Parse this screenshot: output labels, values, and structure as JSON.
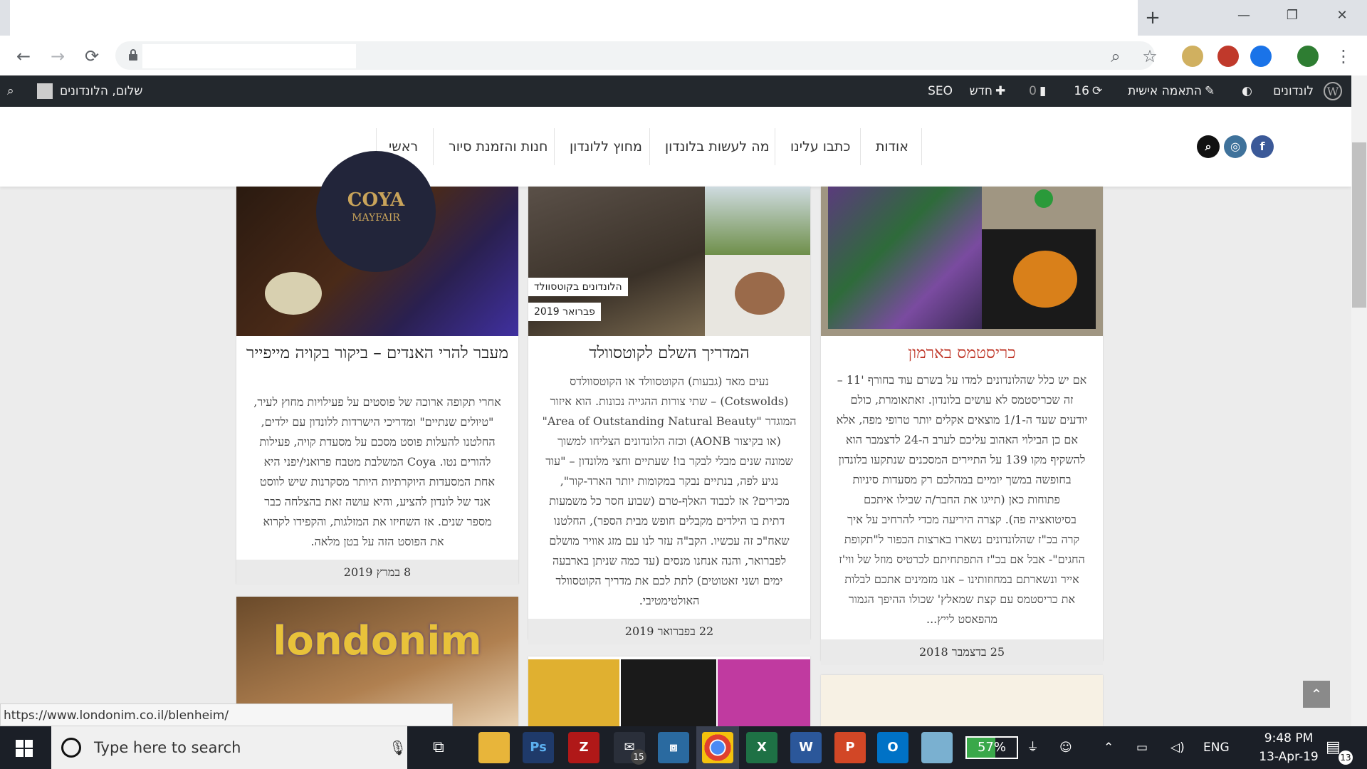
{
  "browser": {
    "new_tab": "+",
    "window_buttons": [
      "—",
      "❐",
      "✕"
    ],
    "back": "←",
    "forward": "→",
    "reload": "⟳",
    "zoom_icon": "⌕",
    "star_icon": "☆",
    "menu_icon": "⋮",
    "extensions": [
      "shield-extension-icon",
      "adblock-extension-icon",
      "a-extension-icon",
      "profile-avatar"
    ],
    "status_url": "https://www.londonim.co.il/blenheim/"
  },
  "admin_bar": {
    "site_name": "לונדונים",
    "customize": "התאמה אישית",
    "updates_count": "16",
    "comments_count": "0",
    "new_label": "חדש",
    "seo_label": "SEO",
    "greeting": "שלום, הלונדונים"
  },
  "nav": {
    "items": [
      "אודות",
      "כתבו עלינו",
      "מה לעשות בלונדון",
      "מחוץ ללונדון",
      "חנות והזמנת סיור",
      "ראשי"
    ]
  },
  "social": {
    "facebook": "f",
    "instagram": "◎",
    "search": "⌕"
  },
  "posts": [
    {
      "title": "כריסטמס בארמון",
      "excerpt": [
        "אם יש כלל שהלונדונים למדו על בשרם עוד בחורף '11 –",
        "זה שכריסטמס לא עושים בלונדון. זאתאומרת, כולם",
        "יודעים שעד ה-1/1 מוצאים אקלים יותר טרופי מפה, אלא",
        "אם כן הבילוי האהוב עליכם לערב ה-24 לדצמבר הוא",
        "להשקיף מקו 139 על התיירים המסכנים שנתקעו בלונדון",
        "בחופשה במשך יומיים במהלכם רק מסעדות סיניות",
        "פתוחות כאן (תייגו את החבר/ה שבילו איתכם",
        "בסיטואציה פה). קצרה היריעה מכדי להרחיב על איך",
        "קרה בכ\"ז שהלונדונים נשארו בארצות הכפור ל\"תקופת",
        "החגים\"- אבל אם בכ\"ז התפתחיתם לכרטיס מוזל של ווי'ז",
        "אייר ונשארתם במחוזותינו – אנו מזמינים אתכם לבלות",
        "את כריסטמס עם קצת שמאלץ' שכולו ההיפך הגמור",
        "מהפאסט לייץ..."
      ],
      "date": "25 בדצמבר 2018"
    },
    {
      "title": "המדריך השלם לקוטסוולד",
      "tags": [
        "הלונדונים בקוטסוולד",
        "פברואר 2019"
      ],
      "excerpt": [
        "נעים מאד (גבעות) הקוטסוולד או הקוטסוולדס",
        "(Cotswolds) – שתי צורות ההגייה נכונות. הוא איזור",
        "המוגדר \"Area of Outstanding Natural Beauty\"",
        "(או בקיצור AONB) וכזה הלונדונים הצליחו למשוך",
        "שמונה שנים מבלי לבקר בו! שעתיים וחצי מלונדון – \"עוד",
        "נגיע לפה, בנתיים נבקר במקומות יותר הארד-קור\",",
        "מכירים? אז לכבוד האלף-טרם (שבוע חסר כל משמעות",
        "דתית בו הילדים מקבלים חופש מבית הספר), החלטנו",
        "שאח\"כ זה עכשיו. הקב\"ה עזר לנו עם מזג אוויר מושלם",
        "לפברואר, והנה אנחנו מנסים (עד כמה שניתן בארבעה",
        "ימים ושני זאטוטים) לתת לכם את מדריך הקוטסוולד",
        "האולטימטיבי."
      ],
      "date": "22 בפברואר 2019"
    },
    {
      "title": "מעבר להרי האנדים – ביקור בקויה מייפייר",
      "image_text": [
        "COYA",
        "MAYFAIR"
      ],
      "excerpt": [
        "אחרי תקופה ארוכה של פוסטים על פעילויות מחוץ לעיר,",
        "\"טיולים שנתיים\" ומדריכי הישרדות ללונדון עם ילדים,",
        "החלטנו להעלות פוסט מסכם על מסעדת קויה, פעילות",
        "להורים נטו. Coya המשלבת מטבח פרואני/יפני היא",
        "אחת המסעדות היוקרתיות היותר מסקרנות שיש לווסט",
        "אנד של לונדון להציע, והיא עושה זאת בהצלחה כבר",
        "מספר שנים. אז השחיזו את המזלגות, והקפידו לקרוא",
        "את הפוסט הזה על בטן מלאה."
      ],
      "date": "8 במרץ 2019"
    },
    {
      "image_text": "londonim"
    }
  ],
  "scroll_top": "⌃",
  "taskbar": {
    "search_placeholder": "Type here to search",
    "mail_badge": "15",
    "battery": "57%",
    "language": "ENG",
    "time": "9:48 PM",
    "date": "13-Apr-19",
    "notification_count": "13"
  },
  "colors": {
    "admin_bar": "#23282d",
    "accent_title": "#c0392b",
    "taskbar": "#1b1f27"
  }
}
